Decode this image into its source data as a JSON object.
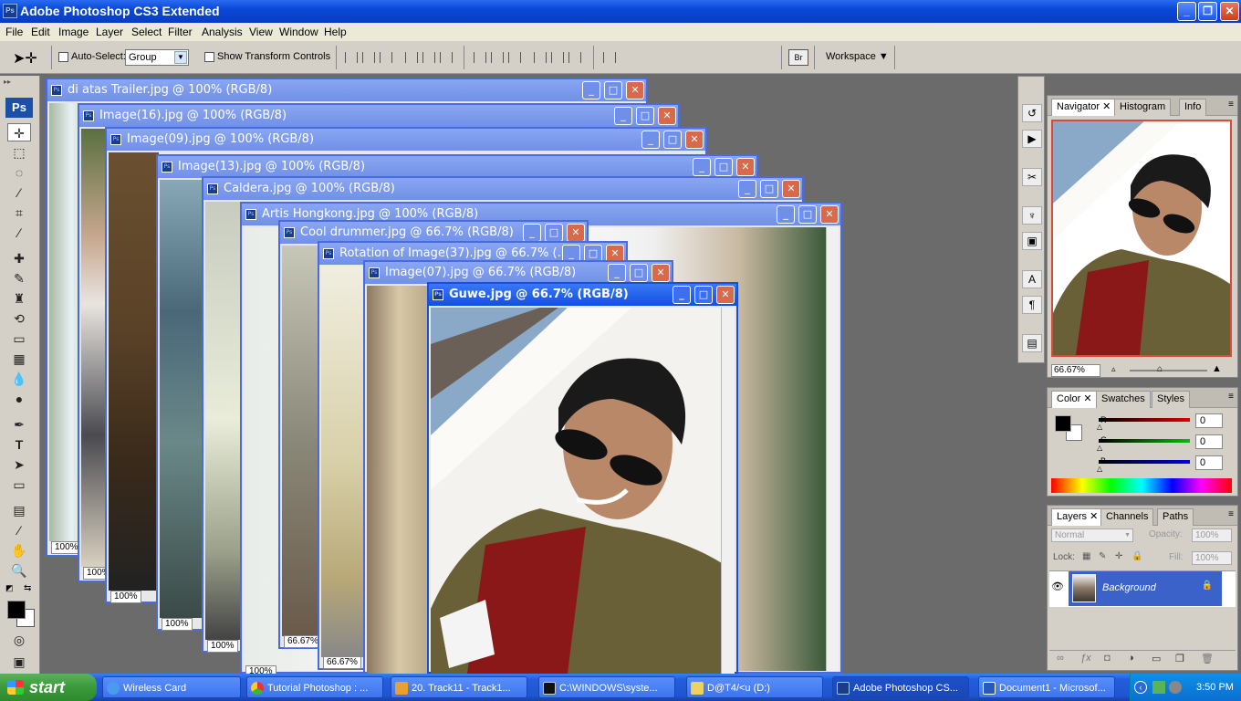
{
  "app": {
    "title": "Adobe Photoshop CS3 Extended",
    "icon_text": "Ps"
  },
  "menu": [
    "File",
    "Edit",
    "Image",
    "Layer",
    "Select",
    "Filter",
    "Analysis",
    "View",
    "Window",
    "Help"
  ],
  "options": {
    "auto_select_label": "Auto-Select:",
    "auto_select_value": "Group",
    "show_transform_label": "Show Transform Controls",
    "workspace_label": "Workspace"
  },
  "documents": [
    {
      "title": "di atas Trailer.jpg @ 100% (RGB/8)",
      "zoom": "100%"
    },
    {
      "title": "Image(16).jpg @ 100% (RGB/8)",
      "zoom": "100%"
    },
    {
      "title": "Image(09).jpg @ 100% (RGB/8)",
      "zoom": "100%"
    },
    {
      "title": "Image(13).jpg @ 100% (RGB/8)",
      "zoom": "100%"
    },
    {
      "title": "Caldera.jpg @ 100% (RGB/8)",
      "zoom": "100%"
    },
    {
      "title": "Artis Hongkong.jpg @ 100% (RGB/8)",
      "zoom": "100%"
    },
    {
      "title": "Cool drummer.jpg @ 66.7% (RGB/8)",
      "zoom": "66.67%"
    },
    {
      "title": "Rotation of Image(37).jpg @ 66.7% (...",
      "zoom": "66.67%"
    },
    {
      "title": "Image(07).jpg @ 66.7% (RGB/8)",
      "zoom": ""
    },
    {
      "title": "Guwe.jpg @ 66.7% (RGB/8)",
      "zoom": ""
    }
  ],
  "navigator": {
    "tabs": [
      "Navigator",
      "Histogram",
      "Info"
    ],
    "zoom": "66.67%"
  },
  "color": {
    "tabs": [
      "Color",
      "Swatches",
      "Styles"
    ],
    "channels": [
      {
        "label": "R",
        "value": "0",
        "color": "#e00000"
      },
      {
        "label": "G",
        "value": "0",
        "color": "#00c000"
      },
      {
        "label": "B",
        "value": "0",
        "color": "#0000e0"
      }
    ]
  },
  "layers": {
    "tabs": [
      "Layers",
      "Channels",
      "Paths"
    ],
    "blend_mode": "Normal",
    "opacity_label": "Opacity:",
    "opacity": "100%",
    "lock_label": "Lock:",
    "fill_label": "Fill:",
    "fill": "100%",
    "layer_name": "Background"
  },
  "taskbar": {
    "start": "start",
    "items": [
      "Wireless Card",
      "Tutorial Photoshop : ...",
      "20. Track11 - Track1...",
      "C:\\WINDOWS\\syste...",
      "D@T4/<u (D:)",
      "Adobe Photoshop CS...",
      "Document1 - Microsof..."
    ],
    "clock": "3:50 PM"
  }
}
